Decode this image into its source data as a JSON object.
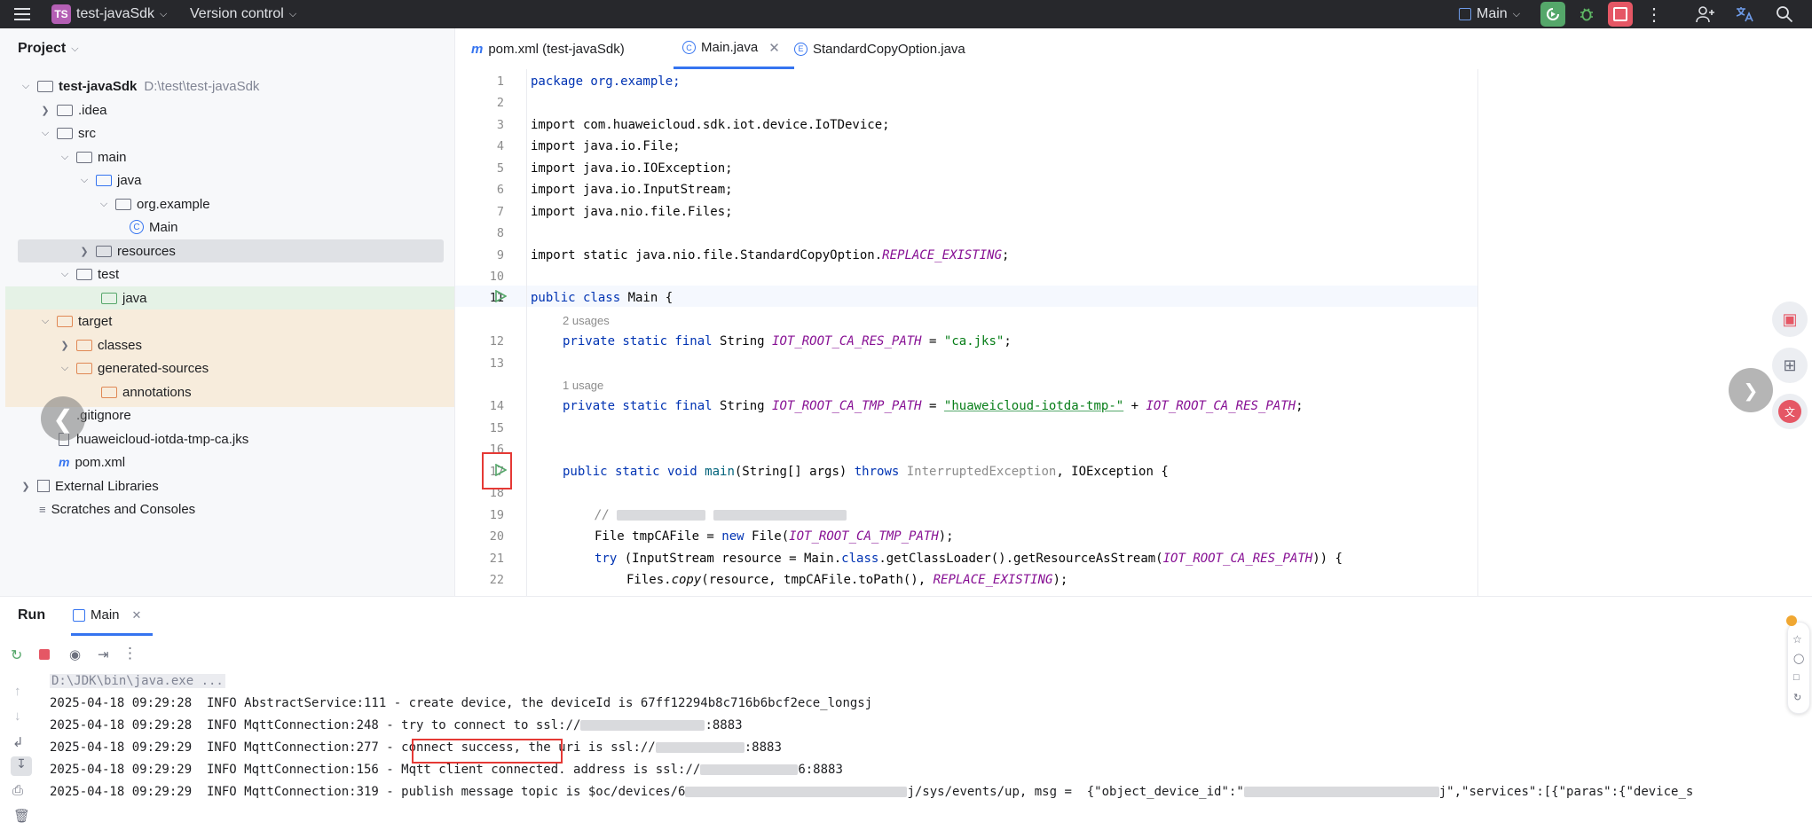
{
  "topbar": {
    "project_badge": "TS",
    "project_name": "test-javaSdk",
    "vcs_label": "Version control",
    "run_config": "Main"
  },
  "project_panel": {
    "title": "Project",
    "tree": [
      {
        "label": "test-javaSdk",
        "extra": "D:\\test\\test-javaSdk"
      },
      {
        "label": ".idea"
      },
      {
        "label": "src"
      },
      {
        "label": "main"
      },
      {
        "label": "java"
      },
      {
        "label": "org.example"
      },
      {
        "label": "Main"
      },
      {
        "label": "resources"
      },
      {
        "label": "test"
      },
      {
        "label": "java"
      },
      {
        "label": "target"
      },
      {
        "label": "classes"
      },
      {
        "label": "generated-sources"
      },
      {
        "label": "annotations"
      },
      {
        "label": ".gitignore"
      },
      {
        "label": "huaweicloud-iotda-tmp-ca.jks"
      },
      {
        "label": "pom.xml"
      },
      {
        "label": "External Libraries"
      },
      {
        "label": "Scratches and Consoles"
      }
    ]
  },
  "editor_tabs": [
    {
      "label": "pom.xml (test-javaSdk)"
    },
    {
      "label": "Main.java"
    },
    {
      "label": "StandardCopyOption.java"
    }
  ],
  "code": {
    "line_numbers": [
      "1",
      "2",
      "3",
      "4",
      "5",
      "6",
      "7",
      "8",
      "9",
      "10",
      "11",
      "12",
      "13",
      "14",
      "15",
      "16",
      "17",
      "18",
      "19",
      "20",
      "21",
      "22"
    ],
    "l1": "package org.example;",
    "l3": "import com.huaweicloud.sdk.iot.device.IoTDevice;",
    "l4": "import java.io.File;",
    "l5": "import java.io.IOException;",
    "l6": "import java.io.InputStream;",
    "l7": "import java.nio.file.Files;",
    "l9_a": "import static java.nio.file.StandardCopyOption.",
    "l9_b": "REPLACE_EXISTING",
    "l9_c": ";",
    "l11_kw": "public class ",
    "l11_rest": "Main {",
    "usages_2": "2 usages",
    "l12_kw": "private static final ",
    "l12_type": "String ",
    "l12_const": "IOT_ROOT_CA_RES_PATH",
    "l12_eq": " = ",
    "l12_str": "\"ca.jks\"",
    "l12_end": ";",
    "usages_1": "1 usage",
    "l14_kw": "private static final ",
    "l14_type": "String ",
    "l14_const": "IOT_ROOT_CA_TMP_PATH",
    "l14_eq": " = ",
    "l14_str": "\"huaweicloud-iotda-tmp-\"",
    "l14_plus": " + ",
    "l14_const2": "IOT_ROOT_CA_RES_PATH",
    "l14_end": ";",
    "l17_kw": "public static void ",
    "l17_fn": "main",
    "l17_args": "(String[] args) ",
    "l17_throws": "throws ",
    "l17_ex1": "InterruptedException",
    "l17_ex2": ", IOException {",
    "l19": "// ",
    "l20_a": "File tmpCAFile = ",
    "l20_new": "new ",
    "l20_b": "File(",
    "l20_const": "IOT_ROOT_CA_TMP_PATH",
    "l20_c": ");",
    "l21_try": "try ",
    "l21_a": "(InputStream resource = Main.",
    "l21_cls": "class",
    "l21_b": ".getClassLoader().getResourceAsStream(",
    "l21_const": "IOT_ROOT_CA_RES_PATH",
    "l21_c": ")) {",
    "l22_a": "Files.",
    "l22_copy": "copy",
    "l22_b": "(resource, tmpCAFile.toPath(), ",
    "l22_const": "REPLACE_EXISTING",
    "l22_c": ");"
  },
  "run_panel": {
    "title": "Run",
    "tab": "Main",
    "command": "D:\\JDK\\bin\\java.exe ...",
    "logs": [
      {
        "a": "2025-04-18 09:29:28  INFO AbstractService:111 - create device, the deviceId is 67ff12294b8c716b6bcf2ece_longsj"
      },
      {
        "a": "2025-04-18 09:29:28  INFO MqttConnection:248 - try to connect to ssl://",
        "b": ":8883"
      },
      {
        "a": "2025-04-18 09:29:29  INFO MqttConnection:277 - connect success, the uri is ssl://",
        "b": ":8883"
      },
      {
        "a": "2025-04-18 09:29:29  INFO MqttConnection:156 - Mqtt client connected. address is ssl://",
        "b": "6:8883"
      },
      {
        "a": "2025-04-18 09:29:29  INFO MqttConnection:319 - publish message topic is $oc/devices/6",
        "b": "j/sys/events/up, msg =  {\"object_device_id\":\"",
        "c": "j\",\"services\":[{\"paras\":{\"device_s"
      }
    ]
  },
  "colors": {
    "accent": "#3574f0",
    "run_green": "#55a76a",
    "stop_red": "#e55765",
    "highlight_red": "#e53935"
  }
}
